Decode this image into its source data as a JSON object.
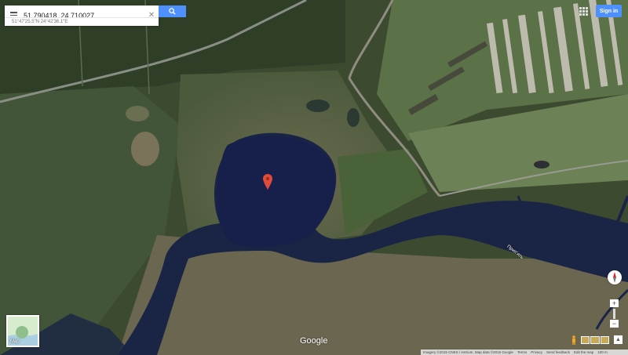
{
  "search": {
    "value": "51.790418, 24.710027",
    "suggestion": "51°47'25.5\"N 24°42'36.1\"E"
  },
  "header": {
    "signin_label": "Sign in"
  },
  "map": {
    "river_label": "Припʼять",
    "logo": "Google",
    "minimap_label": "Map",
    "accent_color": "#4d90fe",
    "pin_color": "#e04b3a"
  },
  "footer": {
    "imagery": "Imagery ©2015 CNES / Astrium, Map data ©2015 Google",
    "terms": "Terms",
    "privacy": "Privacy",
    "send_feedback": "Send feedback",
    "edit_map": "Edit the map",
    "scale": "100 m"
  },
  "controls": {
    "zoom_in": "+",
    "zoom_out": "−"
  }
}
